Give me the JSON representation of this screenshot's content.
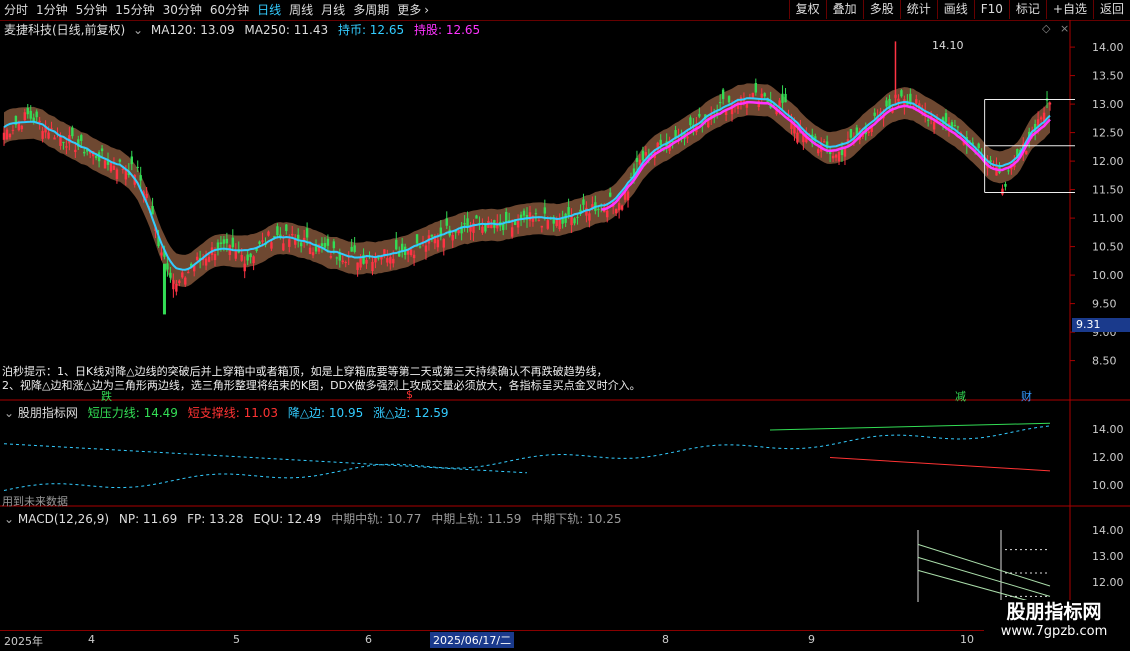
{
  "toolbar": {
    "periods": [
      "分时",
      "1分钟",
      "5分钟",
      "15分钟",
      "30分钟",
      "60分钟",
      "日线",
      "周线",
      "月线",
      "多周期",
      "更多"
    ],
    "active_period": "日线",
    "more_icon": "chevron-right-icon",
    "right_buttons": [
      "复权",
      "叠加",
      "多股",
      "统计",
      "画线",
      "F10",
      "标记",
      "+自选",
      "返回"
    ]
  },
  "main_panel": {
    "title": "麦捷科技(日线,前复权)",
    "indicators": [
      {
        "label": "MA120: 13.09",
        "color": "#dddddd"
      },
      {
        "label": "MA250: 11.43",
        "color": "#dddddd"
      },
      {
        "label": "持币: 12.65",
        "color": "#33ccff"
      },
      {
        "label": "持股: 12.65",
        "color": "#ff33ff"
      }
    ],
    "high_marker": "14.10",
    "low_marker": "9.31",
    "note_line1": "泊秒提示：1、日K线对降△边线的突破后并上穿箱中或者箱顶，如是上穿箱底要等第二天或第三天持续确认不再跌破趋势线，",
    "note_line2": "2、视降△边和涨△边为三角形两边线，选三角形整理将结束的K图，DDX做多强烈上攻成交量必须放大，各指标呈买点金叉时介入。",
    "signals": [
      {
        "text": "跌",
        "color": "#33dd55"
      },
      {
        "text": "$",
        "color": "#ff3333"
      },
      {
        "text": "减",
        "color": "#33dd55"
      },
      {
        "text": "财",
        "color": "#3399ff"
      }
    ]
  },
  "panel2": {
    "title": "股朋指标网",
    "indicators": [
      {
        "label": "短压力线: 14.49",
        "color": "#33dd55"
      },
      {
        "label": "短支撑线: 11.03",
        "color": "#ff3333"
      },
      {
        "label": "降△边: 10.95",
        "color": "#33ccff"
      },
      {
        "label": "涨△边: 12.59",
        "color": "#33ccff"
      }
    ],
    "future_note": "用到未来数据",
    "axis_ticks": [
      "14.00",
      "12.00",
      "10.00"
    ]
  },
  "panel3": {
    "title": "MACD(12,26,9)",
    "indicators": [
      {
        "label": "NP: 11.69",
        "color": "#dddddd"
      },
      {
        "label": "FP: 13.28",
        "color": "#dddddd"
      },
      {
        "label": "EQU: 12.49",
        "color": "#dddddd"
      },
      {
        "label": "中期中轨: 10.77",
        "color": "#999999"
      },
      {
        "label": "中期上轨: 11.59",
        "color": "#999999"
      },
      {
        "label": "中期下轨: 10.25",
        "color": "#999999"
      }
    ],
    "axis_ticks": [
      "14.00",
      "13.00",
      "12.00"
    ]
  },
  "time_axis": {
    "labels": [
      "2025年",
      "4",
      "5",
      "6",
      "2025/06/17/二",
      "8",
      "9",
      "10"
    ],
    "selected": "2025/06/17/二"
  },
  "watermark": {
    "line1": "股朋指标网",
    "line2": "www.7gpzb.com"
  },
  "chart_data": {
    "type": "candlestick",
    "ylim": [
      8.3,
      14.3
    ],
    "yticks": [
      14.0,
      13.5,
      13.0,
      12.5,
      12.0,
      11.5,
      11.0,
      10.5,
      10.0,
      9.5,
      9.0,
      8.5
    ],
    "high": 14.1,
    "low": 9.31,
    "close_anchors": [
      [
        0,
        12.5
      ],
      [
        8,
        12.8
      ],
      [
        20,
        12.4
      ],
      [
        35,
        12.0
      ],
      [
        45,
        11.8
      ],
      [
        48,
        11.4
      ],
      [
        52,
        10.6
      ],
      [
        58,
        9.8
      ],
      [
        64,
        10.2
      ],
      [
        72,
        10.5
      ],
      [
        82,
        10.3
      ],
      [
        90,
        10.7
      ],
      [
        100,
        10.6
      ],
      [
        110,
        10.4
      ],
      [
        120,
        10.3
      ],
      [
        130,
        10.4
      ],
      [
        140,
        10.5
      ],
      [
        150,
        10.8
      ],
      [
        158,
        10.9
      ],
      [
        168,
        10.8
      ],
      [
        178,
        11.0
      ],
      [
        188,
        10.9
      ],
      [
        198,
        11.2
      ],
      [
        208,
        11.3
      ],
      [
        214,
        12.0
      ],
      [
        222,
        12.3
      ],
      [
        232,
        12.6
      ],
      [
        242,
        13.0
      ],
      [
        252,
        13.1
      ],
      [
        262,
        13.0
      ],
      [
        268,
        12.5
      ],
      [
        274,
        12.3
      ],
      [
        280,
        12.1
      ],
      [
        288,
        12.5
      ],
      [
        296,
        12.8
      ],
      [
        302,
        13.2
      ],
      [
        306,
        13.0
      ],
      [
        312,
        12.8
      ],
      [
        320,
        12.6
      ],
      [
        326,
        12.3
      ],
      [
        332,
        12.0
      ],
      [
        336,
        11.6
      ],
      [
        340,
        11.9
      ],
      [
        346,
        12.5
      ],
      [
        350,
        12.9
      ],
      [
        352,
        13.0
      ]
    ],
    "box_top": 13.08,
    "box_mid": 12.27,
    "box_bottom": 11.45
  }
}
